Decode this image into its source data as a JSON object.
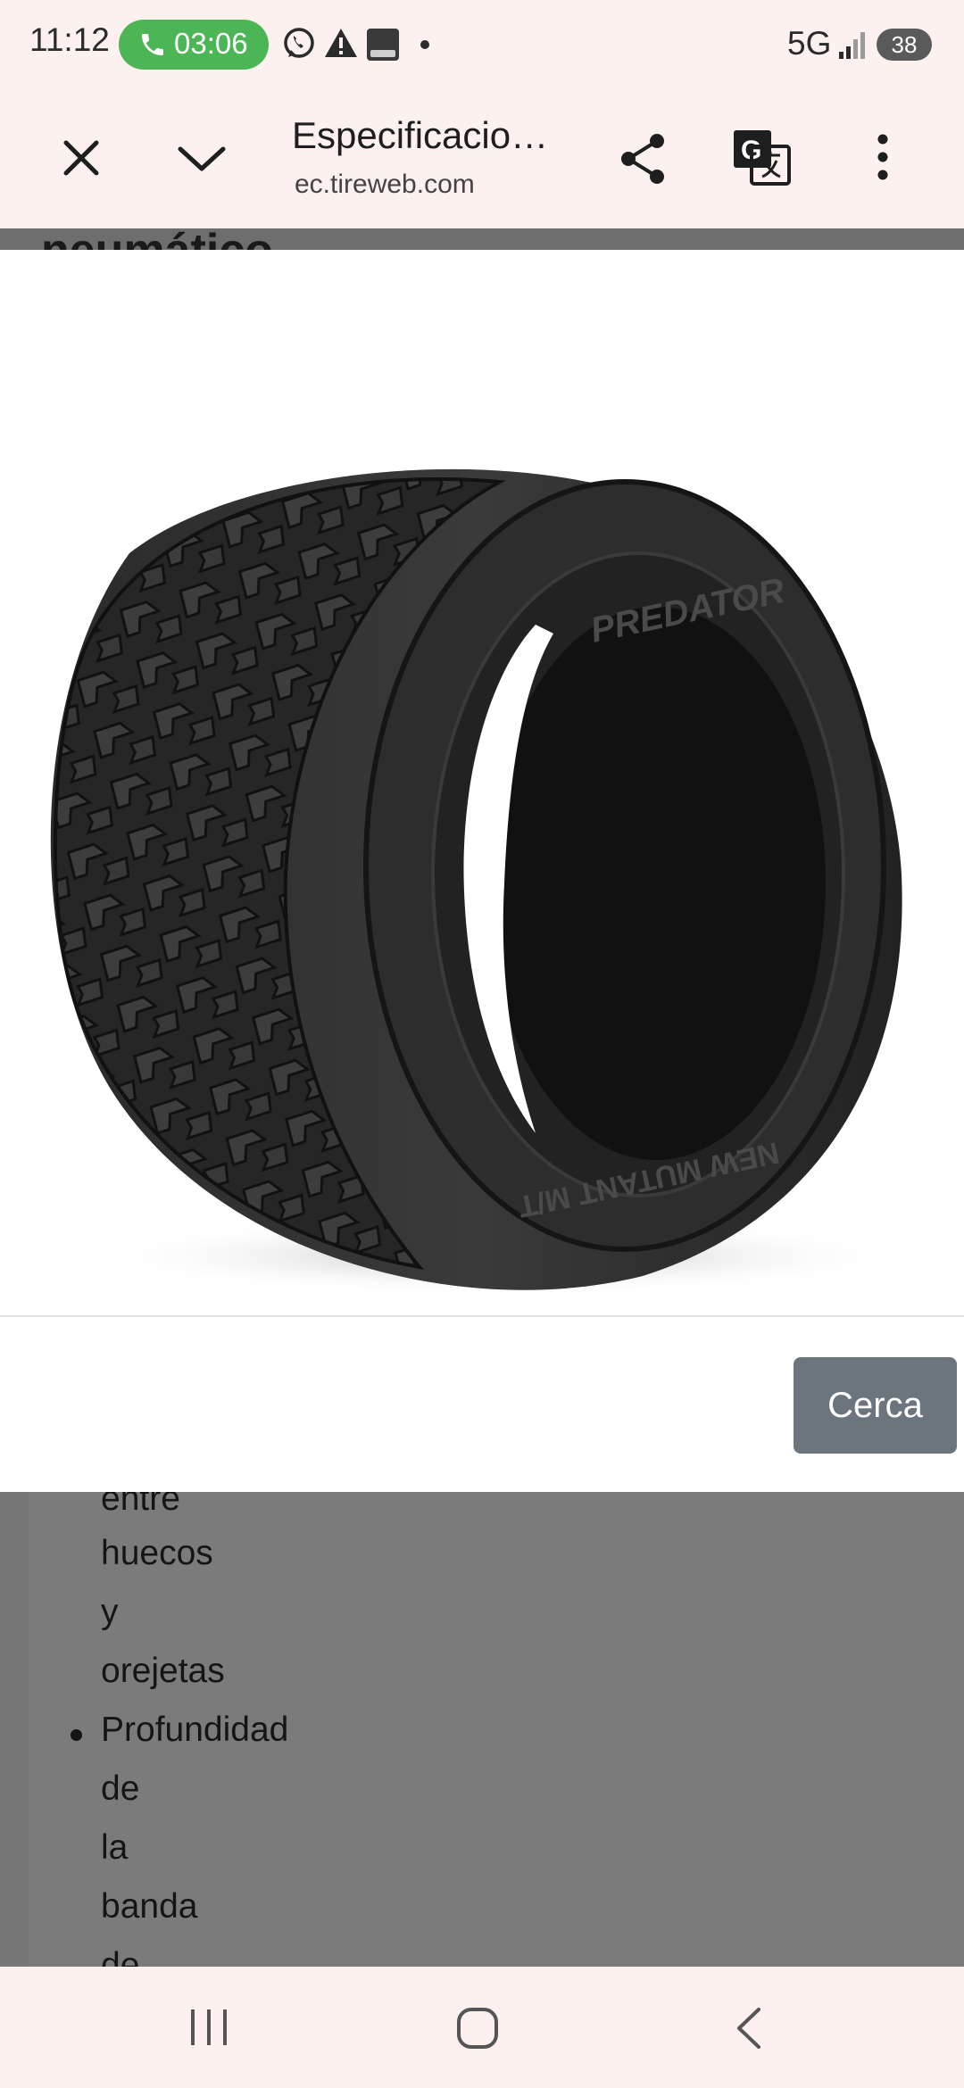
{
  "status_bar": {
    "time": "11:12",
    "call_timer": "03:06",
    "network": "5G",
    "battery": "38",
    "notification_icons": [
      "whatsapp-icon",
      "warning-icon",
      "bible-app-icon",
      "dot-icon"
    ]
  },
  "toolbar": {
    "close_icon": "close-icon",
    "collapse_icon": "chevron-down-icon",
    "page_title": "Especificacio…",
    "url": "ec.tireweb.com",
    "share_icon": "share-icon",
    "translate_icon": "translate-icon",
    "menu_icon": "more-vert-icon"
  },
  "page": {
    "heading_fragment": "neumático"
  },
  "viewer": {
    "brand_on_sidewall": "PREDATOR",
    "model_on_sidewall": "NEW MUTANT M/T",
    "close_button_label": "Cerca"
  },
  "list": {
    "lines": [
      "entre",
      "huecos",
      "y",
      "orejetas",
      "Profundidad",
      "de",
      "la",
      "banda",
      "de"
    ]
  },
  "nav_bar": {
    "icons": [
      "recent-apps-icon",
      "home-icon",
      "back-icon"
    ]
  },
  "colors": {
    "toolbar_bg": "#fcf1ee",
    "call_pill": "#4cb556",
    "cerca_button": "#6c757d",
    "dim_overlay": "#7b7b7b"
  }
}
